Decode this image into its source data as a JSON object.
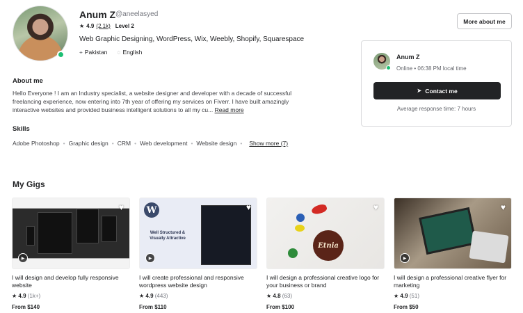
{
  "profile": {
    "name": "Anum Z",
    "handle": "@aneelasyed",
    "rating": "4.9",
    "rating_count": "(2.1k)",
    "level": "Level 2",
    "tagline": "Web Graphic Designing, WordPress, Wix, Weebly, Shopify, Squarespace",
    "location": "Pakistan",
    "language": "English",
    "icons": {
      "location": "map-pin-icon",
      "language": "speech-bubble-icon",
      "star": "star-icon"
    }
  },
  "header": {
    "more_about": "More about me"
  },
  "contact_card": {
    "name": "Anum Z",
    "status": "Online • 06:38 PM local time",
    "button_label": "Contact me",
    "response_time": "Average response time: 7 hours"
  },
  "about": {
    "title": "About me",
    "text": "Hello Everyone ! I am an Industry specialist, a website designer and developer with a decade of successful freelancing experience, now entering into 7th year of offering my services on Fiverr. I have built amazingly interactive websites and provided business intelligent solutions to all my cu...",
    "read_more": "Read more"
  },
  "skills": {
    "title": "Skills",
    "items": [
      "Adobe Photoshop",
      "Graphic design",
      "CRM",
      "Web development",
      "Website design"
    ],
    "show_more": "Show more (7)"
  },
  "gigs": {
    "title": "My Gigs",
    "items": [
      {
        "title": "I will design and develop fully responsive website",
        "rating": "4.9",
        "count": "(1k+)",
        "price": "From $140",
        "has_video": true
      },
      {
        "title": "I will create professional and responsive wordpress website design",
        "rating": "4.9",
        "count": "(443)",
        "price": "From $110",
        "has_video": true,
        "thumb_text": "Well Structured & Visually Attractive"
      },
      {
        "title": "I will design a professional creative logo for your business or brand",
        "rating": "4.8",
        "count": "(63)",
        "price": "From $100",
        "has_video": false,
        "thumb_text": "Etnia"
      },
      {
        "title": "I will design a professional creative flyer for marketing",
        "rating": "4.9",
        "count": "(51)",
        "price": "From $50",
        "has_video": true
      }
    ]
  },
  "colors": {
    "online": "#1dbf73",
    "button_dark": "#222325",
    "text": "#404145"
  }
}
